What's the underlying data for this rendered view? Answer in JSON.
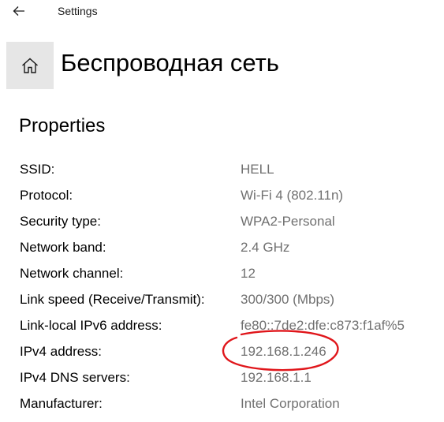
{
  "window": {
    "title": "Settings",
    "back_icon": "back-arrow-icon"
  },
  "header": {
    "home_icon": "home-icon",
    "page_title": "Беспроводная сеть"
  },
  "section": {
    "title": "Properties"
  },
  "properties": [
    {
      "label": "SSID:",
      "value": "HELL"
    },
    {
      "label": "Protocol:",
      "value": "Wi-Fi 4 (802.11n)"
    },
    {
      "label": "Security type:",
      "value": "WPA2-Personal"
    },
    {
      "label": "Network band:",
      "value": "2.4 GHz"
    },
    {
      "label": "Network channel:",
      "value": "12"
    },
    {
      "label": "Link speed (Receive/Transmit):",
      "value": "300/300 (Mbps)"
    },
    {
      "label": "Link-local IPv6 address:",
      "value": "fe80::7de2:dfe:c873:f1af%5"
    },
    {
      "label": "IPv4 address:",
      "value": "192.168.1.246"
    },
    {
      "label": "IPv4 DNS servers:",
      "value": "192.168.1.1"
    },
    {
      "label": "Manufacturer:",
      "value": "Intel Corporation"
    }
  ],
  "colors": {
    "label": "#000000",
    "value": "#707070",
    "home_bg": "#e6e6e6",
    "annotation": "#e0161b"
  }
}
